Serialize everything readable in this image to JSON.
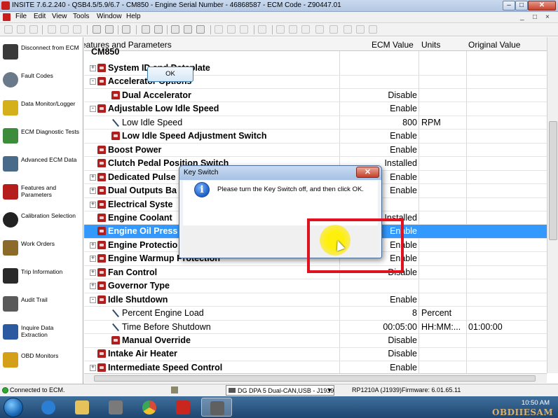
{
  "window": {
    "title": "INSITE 7.6.2.240 - QSB4.5/5.9/6.7 - CM850 - Engine Serial Number - 46868587 - ECM Code - Z90447.01",
    "controls": {
      "minimize": "–",
      "maximize": "□",
      "close": "✕"
    }
  },
  "menu": {
    "items": [
      "File",
      "Edit",
      "View",
      "Tools",
      "Window",
      "Help"
    ],
    "mdi_controls": [
      "_",
      "□",
      "×"
    ]
  },
  "sidebar": {
    "items": [
      {
        "label": "Disconnect from ECM",
        "icon": "disconnect-icon",
        "color": "#3a3a3a"
      },
      {
        "label": "Fault Codes",
        "icon": "fault-codes-icon",
        "color": "#6a7a8a"
      },
      {
        "label": "Data Monitor/Logger",
        "icon": "data-monitor-icon",
        "color": "#d4b01a"
      },
      {
        "label": "ECM Diagnostic Tests",
        "icon": "diagnostic-tests-icon",
        "color": "#3c8c3c"
      },
      {
        "label": "Advanced ECM Data",
        "icon": "advanced-data-icon",
        "color": "#4a6a8a"
      },
      {
        "label": "Features and Parameters",
        "icon": "features-icon",
        "color": "#b51c1c"
      },
      {
        "label": "Calibration Selection",
        "icon": "calibration-icon",
        "color": "#222222"
      },
      {
        "label": "Work Orders",
        "icon": "work-orders-icon",
        "color": "#8c6a2a"
      },
      {
        "label": "Trip Information",
        "icon": "trip-info-icon",
        "color": "#2a2a2a"
      },
      {
        "label": "Audit Trail",
        "icon": "audit-trail-icon",
        "color": "#5a5a5a"
      },
      {
        "label": "Inquire Data Extraction",
        "icon": "inquire-data-icon",
        "color": "#2c5aa0"
      },
      {
        "label": "OBD Monitors",
        "icon": "obd-monitors-icon",
        "color": "#d4a01a"
      }
    ]
  },
  "grid": {
    "columns": [
      "eatures and Parameters",
      "ECM Value",
      "Units",
      "Original Value"
    ],
    "root": "CM850",
    "rows": [
      {
        "name": "System ID and Dataplate",
        "indent": 0,
        "expander": "+",
        "icon": "folder",
        "value": "",
        "units": "",
        "orig": ""
      },
      {
        "name": "Accelerator Options",
        "indent": 0,
        "expander": "−",
        "icon": "folder",
        "value": "",
        "units": "",
        "orig": ""
      },
      {
        "name": "Dual Accelerator",
        "indent": 1,
        "expander": "",
        "icon": "folder",
        "value": "Disable",
        "units": "",
        "orig": ""
      },
      {
        "name": "Adjustable Low Idle Speed",
        "indent": 0,
        "expander": "−",
        "icon": "folder",
        "value": "Enable",
        "units": "",
        "orig": ""
      },
      {
        "name": "Low Idle Speed",
        "indent": 1,
        "expander": "",
        "icon": "param",
        "value": "800",
        "units": "RPM",
        "orig": ""
      },
      {
        "name": "Low Idle Speed Adjustment Switch",
        "indent": 1,
        "expander": "",
        "icon": "folder",
        "value": "Enable",
        "units": "",
        "orig": ""
      },
      {
        "name": "Boost Power",
        "indent": 0,
        "expander": "",
        "icon": "folder",
        "value": "Enable",
        "units": "",
        "orig": ""
      },
      {
        "name": "Clutch Pedal Position Switch",
        "indent": 0,
        "expander": "",
        "icon": "folder",
        "value": "Installed",
        "units": "",
        "orig": ""
      },
      {
        "name": "Dedicated Pulse",
        "indent": 0,
        "expander": "+",
        "icon": "folder",
        "value": "Enable",
        "units": "",
        "orig": ""
      },
      {
        "name": "Dual Outputs Ba",
        "indent": 0,
        "expander": "+",
        "icon": "folder",
        "value": "Enable",
        "units": "",
        "orig": ""
      },
      {
        "name": "Electrical Syste",
        "indent": 0,
        "expander": "+",
        "icon": "folder",
        "value": "",
        "units": "",
        "orig": ""
      },
      {
        "name": "Engine Coolant",
        "indent": 0,
        "expander": "",
        "icon": "folder",
        "value": "Installed",
        "units": "",
        "orig": ""
      },
      {
        "name": "Engine Oil Press",
        "indent": 0,
        "expander": "",
        "icon": "folder",
        "value": "Enable",
        "units": "",
        "orig": "",
        "selected": true
      },
      {
        "name": "Engine Protectio",
        "indent": 0,
        "expander": "+",
        "icon": "folder",
        "value": "Enable",
        "units": "",
        "orig": ""
      },
      {
        "name": "Engine Warmup Protection",
        "indent": 0,
        "expander": "+",
        "icon": "folder",
        "value": "Enable",
        "units": "",
        "orig": ""
      },
      {
        "name": "Fan Control",
        "indent": 0,
        "expander": "+",
        "icon": "folder",
        "value": "Disable",
        "units": "",
        "orig": ""
      },
      {
        "name": "Governor Type",
        "indent": 0,
        "expander": "+",
        "icon": "folder",
        "value": "",
        "units": "",
        "orig": ""
      },
      {
        "name": "Idle Shutdown",
        "indent": 0,
        "expander": "−",
        "icon": "folder",
        "value": "Enable",
        "units": "",
        "orig": ""
      },
      {
        "name": "Percent Engine Load",
        "indent": 1,
        "expander": "",
        "icon": "param",
        "value": "8",
        "units": "Percent",
        "orig": ""
      },
      {
        "name": "Time Before Shutdown",
        "indent": 1,
        "expander": "",
        "icon": "param",
        "value": "00:05:00",
        "units": "HH:MM:...",
        "orig": "01:00:00"
      },
      {
        "name": "Manual Override",
        "indent": 1,
        "expander": "",
        "icon": "folder",
        "value": "Disable",
        "units": "",
        "orig": ""
      },
      {
        "name": "Intake Air Heater",
        "indent": 0,
        "expander": "",
        "icon": "folder",
        "value": "Disable",
        "units": "",
        "orig": ""
      },
      {
        "name": "Intermediate Speed Control",
        "indent": 0,
        "expander": "+",
        "icon": "folder",
        "value": "Enable",
        "units": "",
        "orig": ""
      }
    ]
  },
  "dialog": {
    "title": "Key Switch",
    "message": "Please turn the Key Switch off, and then click OK.",
    "ok_label": "OK",
    "close_label": "✕"
  },
  "status": {
    "connection": "Connected to ECM.",
    "adapter": "DG DPA 5 Dual-CAN,USB - J1939",
    "protocol": "RP1210A (J1939)",
    "firmware": "Firmware: 6.01.65.11"
  },
  "taskbar": {
    "time": "10:50 AM",
    "apps": [
      {
        "icon": "internet-explorer-icon",
        "color": "#2a7fd4"
      },
      {
        "icon": "file-explorer-icon",
        "color": "#e6c25a"
      },
      {
        "icon": "chrome-icon",
        "color": "#d94a38"
      },
      {
        "icon": "acrobat-icon",
        "color": "#c8261e"
      },
      {
        "icon": "insite-icon",
        "color": "#606060"
      }
    ]
  },
  "watermark": "OBDIIESAM",
  "colors": {
    "selection": "#3399ff",
    "folder": "#b01e1e",
    "highlight_box": "#e0121f"
  }
}
